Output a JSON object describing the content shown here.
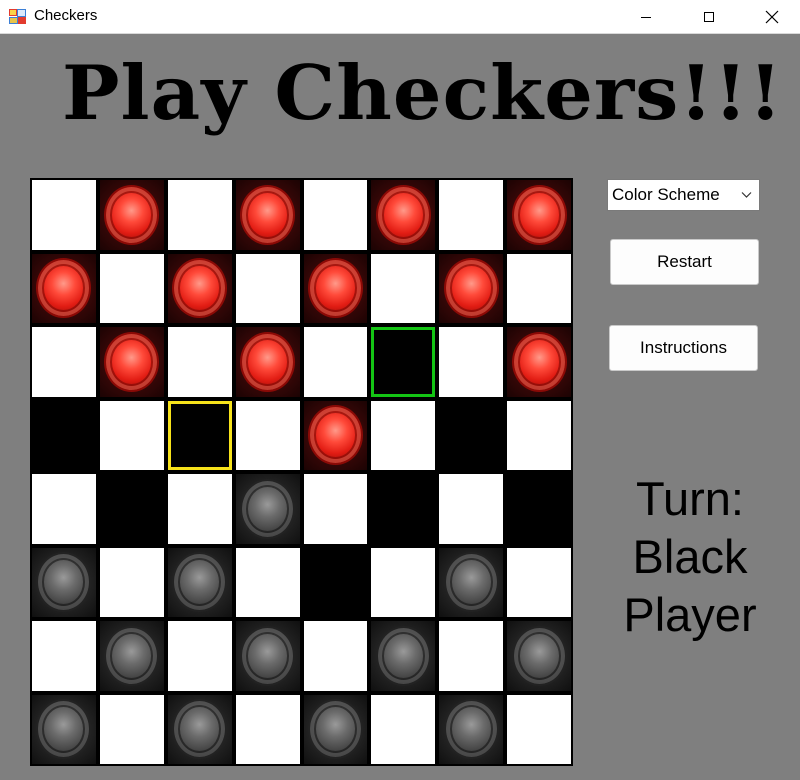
{
  "window": {
    "title": "Checkers",
    "icon": "windows-forms-app-icon",
    "controls": [
      "minimize-icon",
      "maximize-icon",
      "close-icon"
    ]
  },
  "headline": "Play Checkers!!!",
  "colors": {
    "background": "#7f7f7f",
    "light_square": "#ffffff",
    "dark_square": "#000000",
    "red_piece": "#e21d14",
    "black_piece": "#4a4a4a",
    "highlight_yellow": "#f7e31b",
    "highlight_green": "#14c414",
    "highlight_red": "#e21c1c"
  },
  "board": {
    "rows": [
      [
        "light",
        "red",
        "light",
        "red",
        "light",
        "red",
        "light",
        "red"
      ],
      [
        "red",
        "light",
        "red",
        "light",
        "red",
        "light",
        "red",
        "light"
      ],
      [
        "light",
        "red",
        "light",
        "red",
        "light",
        "dark",
        "light",
        "red"
      ],
      [
        "dark",
        "light",
        "dark",
        "light",
        "red",
        "light",
        "dark",
        "light"
      ],
      [
        "light",
        "dark",
        "light",
        "black",
        "light",
        "dark",
        "light",
        "dark"
      ],
      [
        "black",
        "light",
        "black",
        "light",
        "dark",
        "light",
        "black",
        "light"
      ],
      [
        "light",
        "black",
        "light",
        "black",
        "light",
        "black",
        "light",
        "black"
      ],
      [
        "black",
        "light",
        "black",
        "light",
        "black",
        "light",
        "black",
        "light"
      ]
    ],
    "highlights": [
      {
        "row": 2,
        "col": 5,
        "color": "green"
      },
      {
        "row": 3,
        "col": 2,
        "color": "yellow"
      },
      {
        "row": 4,
        "col": 3,
        "color": "red"
      }
    ]
  },
  "controls": {
    "color_scheme": {
      "selected": "Color Scheme"
    },
    "restart_label": "Restart",
    "instructions_label": "Instructions"
  },
  "turn": {
    "line1": "Turn:",
    "line2": "Black",
    "line3": "Player"
  }
}
